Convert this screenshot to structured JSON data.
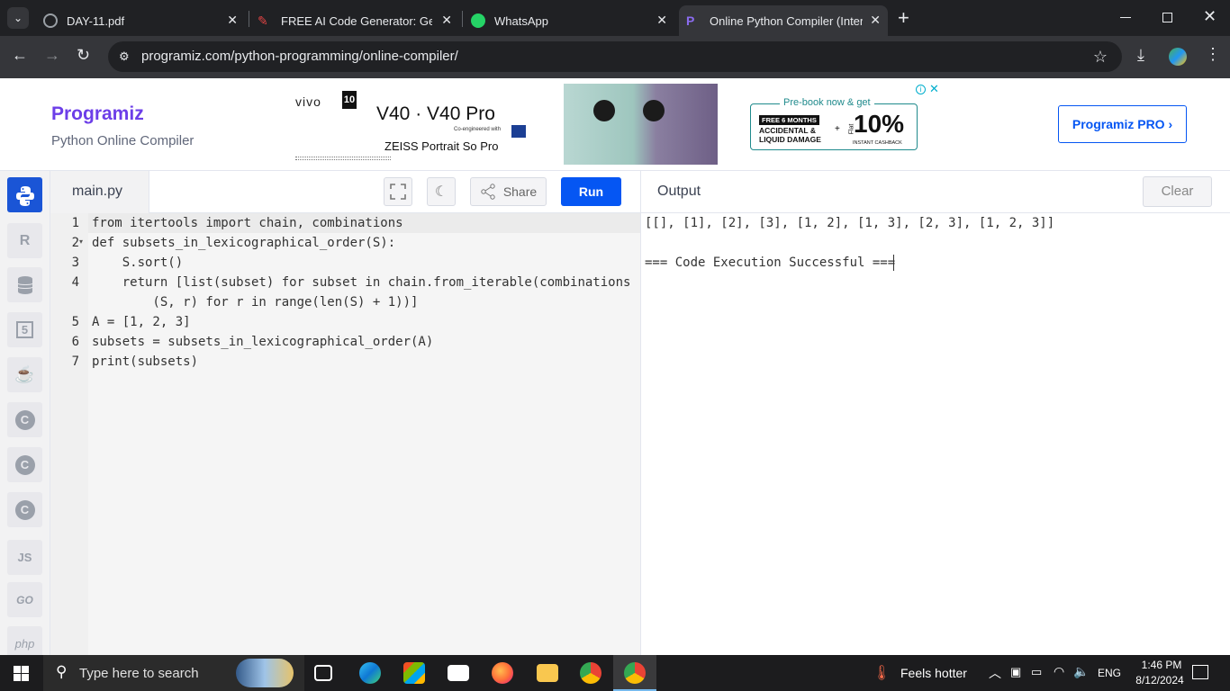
{
  "browser": {
    "tabs": [
      {
        "title": "DAY-11.pdf"
      },
      {
        "title": "FREE AI Code Generator: Gener"
      },
      {
        "title": "WhatsApp"
      },
      {
        "title": "Online Python Compiler (Interpr"
      }
    ],
    "url": "programiz.com/python-programming/online-compiler/",
    "new_tab_label": "+"
  },
  "header": {
    "logo": "Programiz",
    "subtitle": "Python Online Compiler",
    "ad": {
      "brand": "vivo",
      "model": "V40 · V40 Pro",
      "coengineered": "Co-engineered with",
      "tagline": "ZEISS Portrait So Pro",
      "prebook": "Pre-book now & get",
      "offer_line1": "FREE 6 MONTHS",
      "offer_line2": "ACCIDENTAL &",
      "offer_line3": "LIQUID DAMAGE",
      "flat": "Flat",
      "percent": "10%",
      "cashback": "INSTANT CASHBACK"
    },
    "pro_button": "Programiz PRO ›"
  },
  "sidebar": {
    "items": [
      {
        "label": "python",
        "icon": "python-icon"
      },
      {
        "label": "R",
        "icon": "r-icon"
      },
      {
        "label": "",
        "icon": "database-icon"
      },
      {
        "label": "5",
        "icon": "html5-icon"
      },
      {
        "label": "",
        "icon": "java-icon"
      },
      {
        "label": "C",
        "icon": "c-icon"
      },
      {
        "label": "C",
        "icon": "cpp-icon"
      },
      {
        "label": "C",
        "icon": "csharp-icon"
      },
      {
        "label": "JS",
        "icon": "js-icon"
      },
      {
        "label": "GO",
        "icon": "go-icon"
      },
      {
        "label": "php",
        "icon": "php-icon"
      }
    ]
  },
  "editor": {
    "filename": "main.py",
    "share_label": "Share",
    "run_label": "Run",
    "lines": [
      {
        "n": "1",
        "text": "from itertools import chain, combinations"
      },
      {
        "n": "2",
        "text": "def subsets_in_lexicographical_order(S):"
      },
      {
        "n": "3",
        "text": "    S.sort()"
      },
      {
        "n": "4",
        "text": "    return [list(subset) for subset in chain.from_iterable(combinations"
      },
      {
        "n": "",
        "text": "        (S, r) for r in range(len(S) + 1))]"
      },
      {
        "n": "5",
        "text": "A = [1, 2, 3]"
      },
      {
        "n": "6",
        "text": "subsets = subsets_in_lexicographical_order(A)"
      },
      {
        "n": "7",
        "text": "print(subsets)"
      }
    ]
  },
  "output": {
    "title": "Output",
    "clear_label": "Clear",
    "lines": [
      "[[], [1], [2], [3], [1, 2], [1, 3], [2, 3], [1, 2, 3]]",
      "",
      "=== Code Execution Successful ==="
    ]
  },
  "taskbar": {
    "search_placeholder": "Type here to search",
    "weather": "Feels hotter",
    "lang": "ENG",
    "time": "1:46 PM",
    "date": "8/12/2024"
  },
  "colors": {
    "run": "#0556f3",
    "brand": "#6c3ee8",
    "chrome_dark": "#202124"
  }
}
